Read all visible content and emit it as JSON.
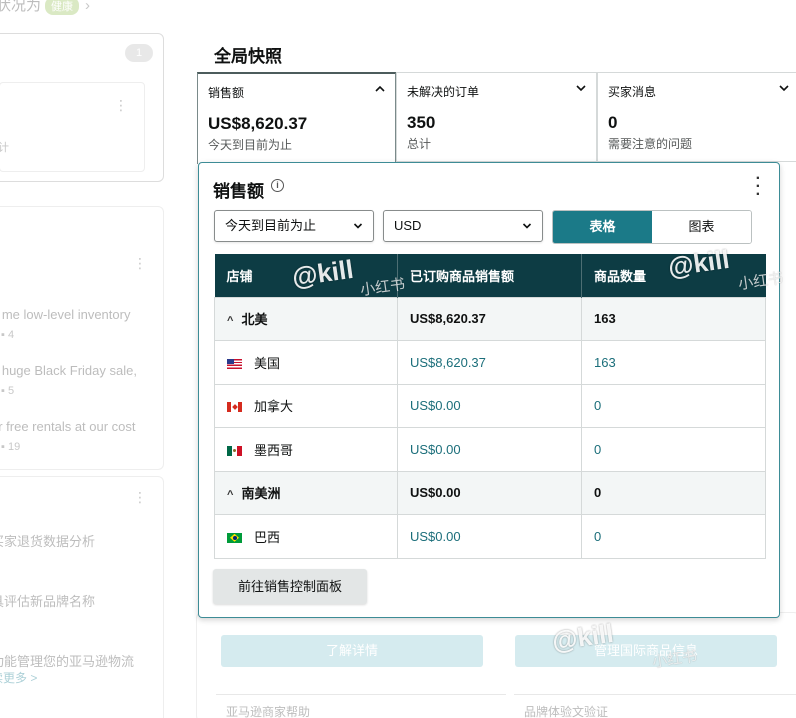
{
  "background": {
    "breadcrumb": "状况为",
    "breadcrumb_badge": "健康",
    "notice_count": "1",
    "notice_snippet": "计",
    "posts": [
      {
        "text": "g me low-level inventory",
        "replies": "4"
      },
      {
        "text": "a huge Black Friday sale,",
        "replies": "5"
      },
      {
        "text": "or free rentals at our cost",
        "replies": "19"
      }
    ],
    "tips": [
      "买家退货数据分析",
      "具评估新品牌名称",
      "功能管理您的亚马逊物流"
    ],
    "tips_link": "读更多 >",
    "learn_more_button": "了解详情",
    "manage_intl_button": "管理国际商品信息",
    "bottom_left_card": "亚马逊商家帮助",
    "bottom_right_card": "品牌体验文验证"
  },
  "snapshot": {
    "title": "全局快照",
    "metrics": [
      {
        "label": "销售额",
        "value": "US$8,620.37",
        "sub": "今天到目前为止",
        "icon": "chevron-up-icon"
      },
      {
        "label": "未解决的订单",
        "value": "350",
        "sub": "总计",
        "icon": "chevron-down-icon"
      },
      {
        "label": "买家消息",
        "value": "0",
        "sub": "需要注意的问题",
        "icon": "chevron-down-icon"
      }
    ]
  },
  "panel": {
    "title": "销售额",
    "period_select": "今天到目前为止",
    "currency_select": "USD",
    "view_toggle": {
      "table": "表格",
      "chart": "图表",
      "selected": "table"
    },
    "columns": [
      "店铺",
      "已订购商品销售额",
      "商品数量"
    ],
    "rows": [
      {
        "type": "region",
        "name": "北美",
        "sales": "US$8,620.37",
        "units": "163",
        "expanded": true
      },
      {
        "type": "store",
        "flag": "us",
        "name": "美国",
        "sales": "US$8,620.37",
        "units": "163"
      },
      {
        "type": "store",
        "flag": "ca",
        "name": "加拿大",
        "sales": "US$0.00",
        "units": "0"
      },
      {
        "type": "store",
        "flag": "mx",
        "name": "墨西哥",
        "sales": "US$0.00",
        "units": "0"
      },
      {
        "type": "region",
        "name": "南美洲",
        "sales": "US$0.00",
        "units": "0",
        "expanded": true
      },
      {
        "type": "store",
        "flag": "br",
        "name": "巴西",
        "sales": "US$0.00",
        "units": "0"
      }
    ],
    "dashboard_button": "前往销售控制面板"
  },
  "watermarks": [
    "@kill",
    "小红书",
    "@kill",
    "小红书",
    "@kill",
    "小红书"
  ],
  "colors": {
    "header_bg": "#0d3c44",
    "toggle_on": "#1b7a88",
    "accent_teal": "#1b6e7a",
    "panel_border": "#3d8c96"
  }
}
